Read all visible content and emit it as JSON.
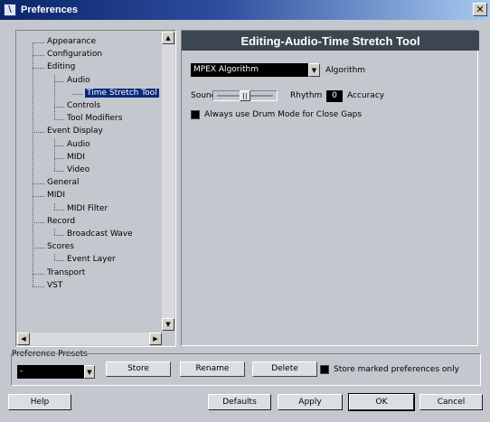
{
  "window": {
    "title": "Preferences",
    "close_glyph": "✕",
    "app_icon_glyph": "\\"
  },
  "tree": {
    "items": [
      {
        "label": "Appearance",
        "level": 0
      },
      {
        "label": "Configuration",
        "level": 0
      },
      {
        "label": "Editing",
        "level": 0
      },
      {
        "label": "Audio",
        "level": 1
      },
      {
        "label": "Time Stretch Tool",
        "level": 2,
        "selected": true
      },
      {
        "label": "Controls",
        "level": 1
      },
      {
        "label": "Tool Modifiers",
        "level": 1
      },
      {
        "label": "Event Display",
        "level": 0
      },
      {
        "label": "Audio",
        "level": 1
      },
      {
        "label": "MIDI",
        "level": 1
      },
      {
        "label": "Video",
        "level": 1
      },
      {
        "label": "General",
        "level": 0
      },
      {
        "label": "MIDI",
        "level": 0
      },
      {
        "label": "MIDI Filter",
        "level": 1
      },
      {
        "label": "Record",
        "level": 0
      },
      {
        "label": "Broadcast Wave",
        "level": 1
      },
      {
        "label": "Scores",
        "level": 0
      },
      {
        "label": "Event Layer",
        "level": 1
      },
      {
        "label": "Transport",
        "level": 0
      },
      {
        "label": "VST",
        "level": 0
      }
    ],
    "scroll_up_glyph": "▲",
    "scroll_down_glyph": "▼",
    "scroll_left_glyph": "◀",
    "scroll_right_glyph": "▶"
  },
  "settings": {
    "header": "Editing-Audio-Time Stretch Tool",
    "algorithm": {
      "value": "MPEX Algorithm",
      "label": "Algorithm",
      "arrow_glyph": "▼"
    },
    "slider": {
      "left_label": "Sound",
      "right_label": "Rhythm",
      "position": 0.5
    },
    "accuracy": {
      "value": "0",
      "label": "Accuracy"
    },
    "drum_mode": {
      "label": "Always use Drum Mode for Close Gaps",
      "checked": false
    }
  },
  "presets": {
    "label": "Preference Presets",
    "value": "-",
    "arrow_glyph": "▼",
    "store_label": "Store",
    "rename_label": "Rename",
    "delete_label": "Delete",
    "marked_only_label": "Store marked preferences only"
  },
  "footer": {
    "help_label": "Help",
    "defaults_label": "Defaults",
    "apply_label": "Apply",
    "ok_label": "OK",
    "cancel_label": "Cancel"
  }
}
